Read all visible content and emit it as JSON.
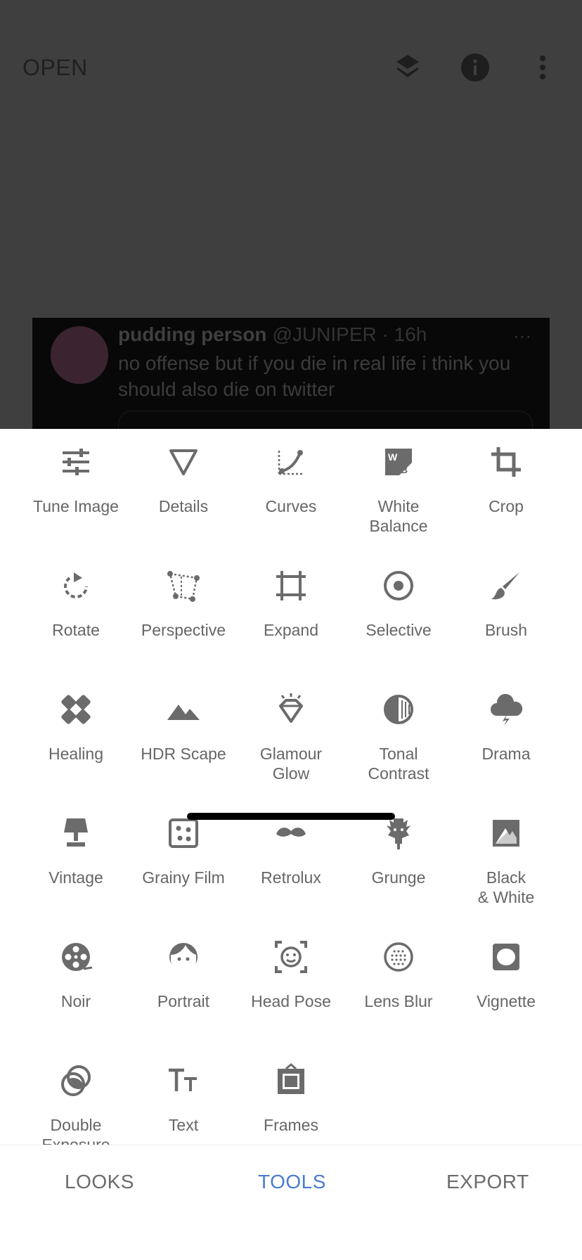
{
  "topbar": {
    "open_label": "OPEN",
    "icons": [
      "layers-refresh-icon",
      "info-icon",
      "more-vert-icon"
    ]
  },
  "preview": {
    "tweet_name": "pudding person",
    "tweet_handle": "@JUNIPER · 16h",
    "tweet_dots": "···",
    "tweet_text": "no offense but if you die in real life i think you should also die on twitter"
  },
  "tools": [
    {
      "label": "Tune Image",
      "icon": "tune-icon"
    },
    {
      "label": "Details",
      "icon": "details-triangle-icon"
    },
    {
      "label": "Curves",
      "icon": "curves-icon"
    },
    {
      "label": "White\nBalance",
      "icon": "white-balance-icon"
    },
    {
      "label": "Crop",
      "icon": "crop-icon"
    },
    {
      "label": "Rotate",
      "icon": "rotate-icon"
    },
    {
      "label": "Perspective",
      "icon": "perspective-icon"
    },
    {
      "label": "Expand",
      "icon": "expand-icon"
    },
    {
      "label": "Selective",
      "icon": "selective-icon"
    },
    {
      "label": "Brush",
      "icon": "brush-icon"
    },
    {
      "label": "Healing",
      "icon": "healing-icon"
    },
    {
      "label": "HDR Scape",
      "icon": "mountains-icon"
    },
    {
      "label": "Glamour\nGlow",
      "icon": "diamond-icon"
    },
    {
      "label": "Tonal\nContrast",
      "icon": "tonal-contrast-icon"
    },
    {
      "label": "Drama",
      "icon": "storm-cloud-icon"
    },
    {
      "label": "Vintage",
      "icon": "lamp-icon"
    },
    {
      "label": "Grainy Film",
      "icon": "grainy-film-icon"
    },
    {
      "label": "Retrolux",
      "icon": "mustache-icon"
    },
    {
      "label": "Grunge",
      "icon": "guitar-icon"
    },
    {
      "label": "Black\n& White",
      "icon": "black-white-icon"
    },
    {
      "label": "Noir",
      "icon": "film-reel-icon"
    },
    {
      "label": "Portrait",
      "icon": "face-icon"
    },
    {
      "label": "Head Pose",
      "icon": "head-pose-icon"
    },
    {
      "label": "Lens Blur",
      "icon": "lens-blur-icon"
    },
    {
      "label": "Vignette",
      "icon": "vignette-icon"
    },
    {
      "label": "Double\nExposure",
      "icon": "double-exposure-icon"
    },
    {
      "label": "Text",
      "icon": "text-icon"
    },
    {
      "label": "Frames",
      "icon": "frames-icon"
    }
  ],
  "nav": {
    "looks": "LOOKS",
    "tools": "TOOLS",
    "export": "EXPORT",
    "active": "tools"
  },
  "colors": {
    "accent": "#4a7bd0",
    "icon": "#6b6b6b",
    "label": "#666666",
    "dim_overlay": "#3f3f3f"
  }
}
